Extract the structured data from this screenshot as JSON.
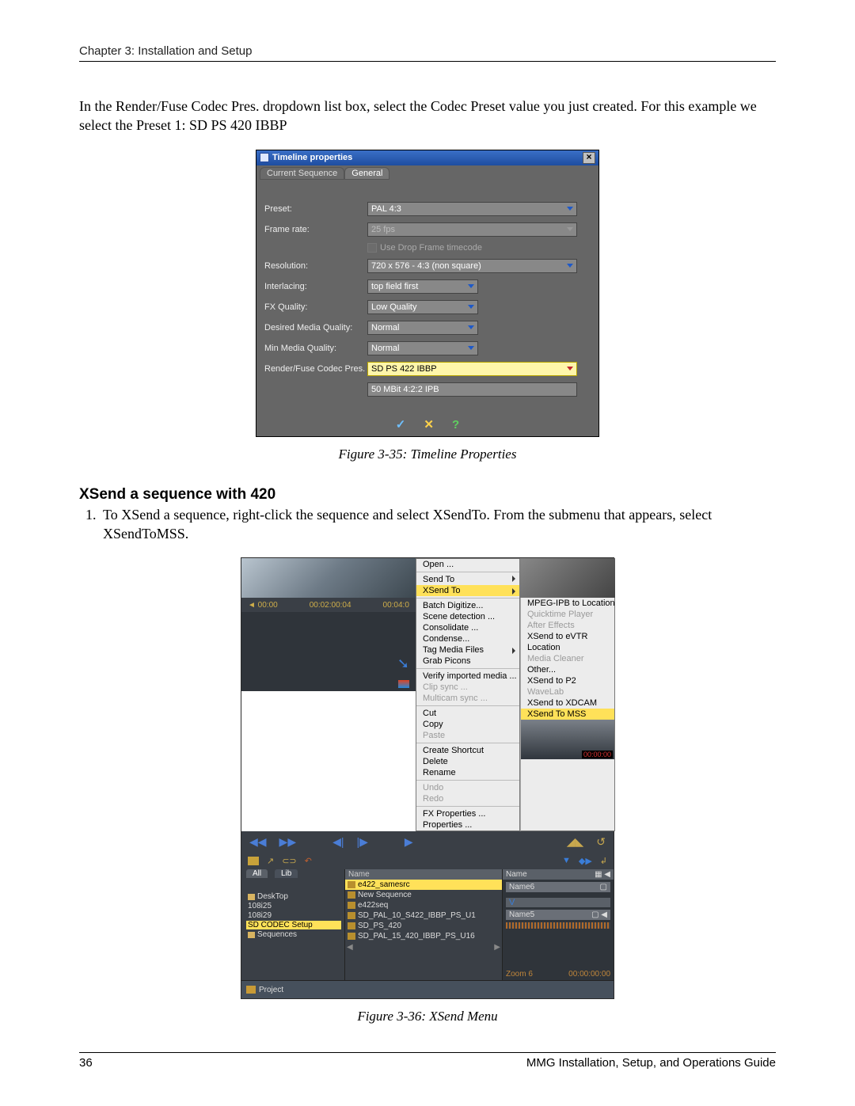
{
  "header": "Chapter 3: Installation and Setup",
  "para1": "In the Render/Fuse Codec Pres. dropdown list box, select the Codec Preset value you just created. For this example we select the Preset 1: SD PS 420 IBBP",
  "caption1": "Figure 3-35: Timeline Properties",
  "h3": "XSend a sequence with 420",
  "step1": "To XSend a sequence, right-click the sequence and select XSendTo. From the submenu that appears, select XSendToMSS.",
  "caption2": "Figure 3-36: XSend Menu",
  "footer_page": "36",
  "footer_right": "MMG Installation, Setup, and Operations Guide",
  "tp": {
    "title": "Timeline properties",
    "tabs": {
      "t1": "Current Sequence",
      "t2": "General"
    },
    "rows": {
      "preset_l": "Preset:",
      "preset_v": "PAL   4:3",
      "fps_l": "Frame rate:",
      "fps_v": "25 fps",
      "drop": "Use Drop Frame timecode",
      "res_l": "Resolution:",
      "res_v": "720 x 576 - 4:3 (non square)",
      "int_l": "Interlacing:",
      "int_v": "top field first",
      "fx_l": "FX Quality:",
      "fx_v": "Low Quality",
      "dmq_l": "Desired Media Quality:",
      "dmq_v": "Normal",
      "mmq_l": "Min Media Quality:",
      "mmq_v": "Normal",
      "rfc_l": "Render/Fuse Codec Pres.",
      "rfc_v": "SD PS 422 IBBP",
      "rfc2": "50 MBit 4:2:2 IPB"
    }
  },
  "xs": {
    "menu": {
      "open": "Open ...",
      "sendto": "Send To",
      "xsendto": "XSend To",
      "batch": "Batch Digitize...",
      "scene": "Scene detection ...",
      "consol": "Consolidate ...",
      "cond": "Condense...",
      "tag": "Tag Media Files",
      "grab": "Grab Picons",
      "verify": "Verify imported media ...",
      "clipsync": "Clip sync ...",
      "multicam": "Multicam sync ...",
      "cut": "Cut",
      "copy": "Copy",
      "paste": "Paste",
      "shortcut": "Create Shortcut",
      "delete": "Delete",
      "rename": "Rename",
      "undo": "Undo",
      "redo": "Redo",
      "fxprop": "FX Properties ...",
      "prop": "Properties ..."
    },
    "submenu": {
      "mpeg": "MPEG-IPB to Location",
      "qt": "Quicktime Player",
      "ae": "After Effects",
      "evtr": "XSend to eVTR",
      "loc": "Location",
      "mc": "Media Cleaner",
      "other": "Other...",
      "p2": "XSend to P2",
      "wavelab": "WaveLab",
      "xdcam": "XSend to XDCAM",
      "mss": "XSend To MSS"
    },
    "timeline_tc1": "00:02:00:04",
    "thumb_tc": "00:00:00",
    "tree_tab1": "All",
    "tree_tab2": "Lib",
    "tree": {
      "desk": "DeskTop",
      "i1": "108i25",
      "i2": "108i29",
      "sd": "SD CODEC Setup",
      "seq": "Sequences"
    },
    "list_hdr": "Name",
    "list": {
      "r1": "e422_samesrc",
      "r2": "New Sequence",
      "r3": "e422seq",
      "r4": "SD_PAL_10_S422_IBBP_PS_U1",
      "r5": "SD_PS_420",
      "r6": "SD_PAL_15_420_IBBP_PS_U16"
    },
    "right_hdr": "Name",
    "right_cell1": "Name6",
    "right_cell2": "Name5",
    "zoom_l": "Zoom  6",
    "zoom_r": "00:00:00:00",
    "project": "Project"
  }
}
